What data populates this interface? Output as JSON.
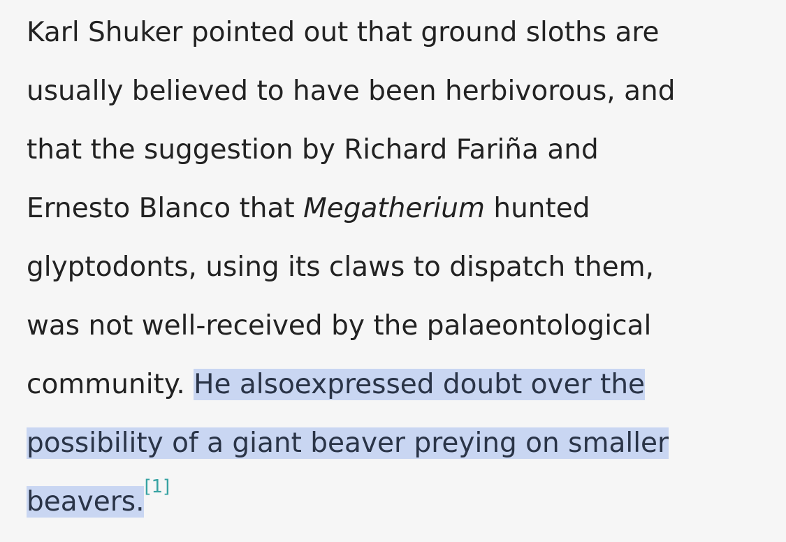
{
  "paragraph": {
    "line1": "Karl Shuker pointed out that ground sloths are",
    "line2": "usually believed to have been herbivorous, and",
    "line3": "that the suggestion by Richard Fariña and",
    "line4_pre": "Ernesto Blanco that ",
    "line4_italic": "Megatherium",
    "line4_post": " hunted",
    "line5": "glyptodonts, using its claws to dispatch them,",
    "line6": "was not well-received by the palaeontological",
    "line7_plain": "community. ",
    "line7_highlight": "He alsoexpressed doubt over the",
    "line8_highlight": "possibility of a giant beaver preying on smaller",
    "line9_highlight": "beavers.",
    "citation": "[1]"
  },
  "colors": {
    "background": "#f6f6f6",
    "text": "#222222",
    "highlight": "#c9d6f2",
    "citation_link": "#36a2a2"
  }
}
